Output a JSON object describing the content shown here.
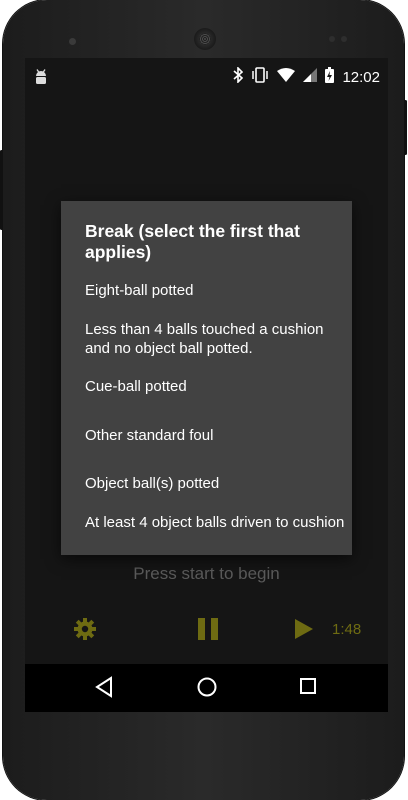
{
  "statusbar": {
    "time": "12:02",
    "icons": [
      "android-debug-icon",
      "bluetooth-icon",
      "vibrate-icon",
      "wifi-icon",
      "signal-icon",
      "battery-icon"
    ]
  },
  "dialog": {
    "title": "Break (select the first that applies)",
    "items": [
      {
        "label": "Eight-ball potted"
      },
      {
        "label": "Less than 4 balls touched a cushion and no object ball potted."
      },
      {
        "label": "Cue-ball potted"
      },
      {
        "label": "Other standard foul"
      },
      {
        "label": "Object ball(s) potted"
      },
      {
        "label": "At least 4 object balls driven to cushion"
      }
    ]
  },
  "main": {
    "prompt": "Press start to begin",
    "timer": "1:48",
    "accent_color": "#6e6b12"
  },
  "navbar": {
    "buttons": [
      "back-icon",
      "home-icon",
      "recents-icon"
    ]
  }
}
